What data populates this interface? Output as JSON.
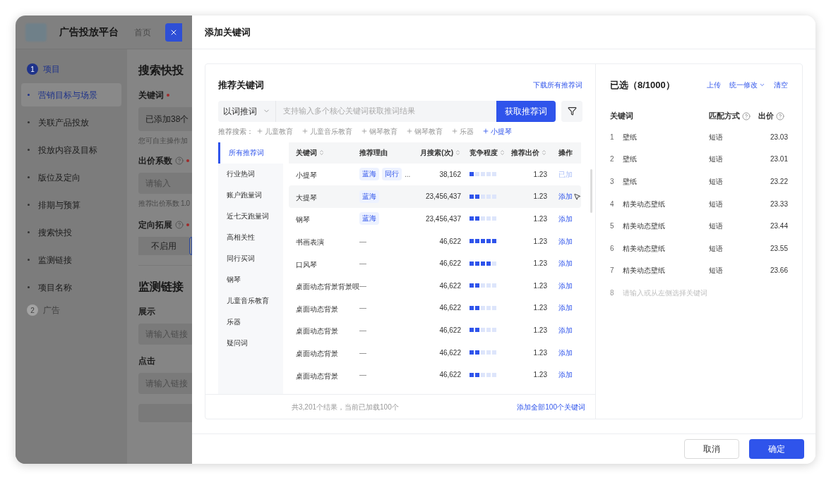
{
  "background_app": {
    "title": "广告投放平台",
    "nav": [
      {
        "label": "首页"
      }
    ],
    "steps": [
      {
        "number": "1",
        "label": "项目",
        "active": true,
        "items": [
          {
            "label": "营销目标与场景",
            "selected": true
          },
          {
            "label": "关联产品投放",
            "selected": false
          },
          {
            "label": "投放内容及目标",
            "selected": false
          },
          {
            "label": "版位及定向",
            "selected": false
          },
          {
            "label": "排期与预算",
            "selected": false
          },
          {
            "label": "搜索快投",
            "selected": false
          },
          {
            "label": "监测链接",
            "selected": false
          },
          {
            "label": "项目名称",
            "selected": false
          }
        ]
      },
      {
        "number": "2",
        "label": "广告",
        "active": false
      }
    ],
    "sections": [
      {
        "title": "搜索快投",
        "fields": [
          {
            "kind": "value",
            "label": "关键词",
            "required": true,
            "help": false,
            "value": "已添加38个",
            "hint": "您可自主操作加"
          },
          {
            "kind": "input",
            "label": "出价系数",
            "required": true,
            "help": true,
            "placeholder": "请输入",
            "hint": "推荐出价系数 1.0"
          },
          {
            "kind": "segmented",
            "label": "定向拓展",
            "required": true,
            "help": true,
            "options": [
              "不启用"
            ]
          }
        ]
      },
      {
        "title": "监测链接",
        "fields": [
          {
            "kind": "input",
            "label": "展示",
            "required": false,
            "help": false,
            "placeholder": "请输入链接"
          },
          {
            "kind": "input",
            "label": "点击",
            "required": false,
            "help": false,
            "placeholder": "请输入链接"
          },
          {
            "kind": "block"
          }
        ]
      }
    ]
  },
  "drawer": {
    "title": "添加关键词",
    "recommend": {
      "title": "推荐关键词",
      "download_link": "下载所有推荐词",
      "mode": "以词推词",
      "search_placeholder": "支持输入多个核心关键词获取推词结果",
      "search_button": "获取推荐词",
      "suggest_label": "推荐搜索：",
      "suggestions": [
        {
          "label": "儿童教育",
          "selected": false
        },
        {
          "label": "儿童音乐教育",
          "selected": false
        },
        {
          "label": "钢琴教育",
          "selected": false
        },
        {
          "label": "钢琴教育",
          "selected": false
        },
        {
          "label": "乐器",
          "selected": false
        },
        {
          "label": "小提琴",
          "selected": true
        }
      ],
      "categories": [
        {
          "label": "所有推荐词",
          "selected": true
        },
        {
          "label": "行业热词",
          "selected": false
        },
        {
          "label": "账户跑量词",
          "selected": false
        },
        {
          "label": "近七天跑量词",
          "selected": false
        },
        {
          "label": "高相关性",
          "selected": false
        },
        {
          "label": "同行买词",
          "selected": false
        },
        {
          "label": "钢琴",
          "selected": false
        },
        {
          "label": "儿童音乐教育",
          "selected": false
        },
        {
          "label": "乐器",
          "selected": false
        },
        {
          "label": "疑问词",
          "selected": false
        }
      ],
      "table": {
        "columns": [
          {
            "label": "关键词",
            "sortable": true
          },
          {
            "label": "推荐理由",
            "sortable": false
          },
          {
            "label": "月搜索(次)",
            "sortable": true
          },
          {
            "label": "竞争程度",
            "sortable": true
          },
          {
            "label": "推荐出价",
            "sortable": true
          },
          {
            "label": "操作",
            "sortable": false
          }
        ],
        "rows": [
          {
            "keyword": "小提琴",
            "tags": [
              "蓝海",
              "同行"
            ],
            "more": "...",
            "searches": "38,162",
            "level": 0.2,
            "bid": "1.23",
            "action": "已加",
            "added": true,
            "highlighted": false
          },
          {
            "keyword": "大提琴",
            "tags": [
              "蓝海"
            ],
            "searches": "23,456,437",
            "level": 0.4,
            "bid": "1.23",
            "action": "添加",
            "added": false,
            "highlighted": true
          },
          {
            "keyword": "钢琴",
            "tags": [
              "蓝海"
            ],
            "searches": "23,456,437",
            "level": 0.4,
            "bid": "1.23",
            "action": "添加",
            "added": false,
            "highlighted": false
          },
          {
            "keyword": "书画表演",
            "reason": "—",
            "searches": "46,622",
            "level": 1,
            "bid": "1.23",
            "action": "添加",
            "added": false,
            "highlighted": false
          },
          {
            "keyword": "口风琴",
            "reason": "—",
            "searches": "46,622",
            "level": 0.8,
            "bid": "1.23",
            "action": "添加",
            "added": false,
            "highlighted": false
          },
          {
            "keyword": "桌面动态背景背景呗",
            "reason": "—",
            "searches": "46,622",
            "level": 0.4,
            "bid": "1.23",
            "action": "添加",
            "added": false,
            "highlighted": false
          },
          {
            "keyword": "桌面动态背景",
            "reason": "—",
            "searches": "46,622",
            "level": 0.4,
            "bid": "1.23",
            "action": "添加",
            "added": false,
            "highlighted": false
          },
          {
            "keyword": "桌面动态背景",
            "reason": "—",
            "searches": "46,622",
            "level": 0.4,
            "bid": "1.23",
            "action": "添加",
            "added": false,
            "highlighted": false
          },
          {
            "keyword": "桌面动态背景",
            "reason": "—",
            "searches": "46,622",
            "level": 0.4,
            "bid": "1.23",
            "action": "添加",
            "added": false,
            "highlighted": false
          },
          {
            "keyword": "桌面动态背景",
            "reason": "—",
            "searches": "46,622",
            "level": 0.4,
            "bid": "1.23",
            "action": "添加",
            "added": false,
            "highlighted": false
          }
        ]
      },
      "summary": "共3,201个结果，当前已加载100个",
      "add_all": "添加全部100个关键词"
    },
    "selected": {
      "title": "已选（8/1000）",
      "actions": [
        {
          "label": "上传",
          "dropdown": false
        },
        {
          "label": "统一修改",
          "dropdown": true
        },
        {
          "label": "清空",
          "dropdown": false
        }
      ],
      "columns": [
        {
          "label": "关键词",
          "help": false
        },
        {
          "label": "匹配方式",
          "help": true
        },
        {
          "label": "出价",
          "help": true
        }
      ],
      "rows": [
        {
          "index": "1",
          "keyword": "壁纸",
          "match": "短语",
          "bid": "23.03"
        },
        {
          "index": "2",
          "keyword": "壁纸",
          "match": "短语",
          "bid": "23.01"
        },
        {
          "index": "3",
          "keyword": "壁纸",
          "match": "短语",
          "bid": "23.22"
        },
        {
          "index": "4",
          "keyword": "精美动态壁纸",
          "match": "短语",
          "bid": "23.33"
        },
        {
          "index": "5",
          "keyword": "精美动态壁纸",
          "match": "短语",
          "bid": "23.44"
        },
        {
          "index": "6",
          "keyword": "精美动态壁纸",
          "match": "短语",
          "bid": "23.55"
        },
        {
          "index": "7",
          "keyword": "精美动态壁纸",
          "match": "短语",
          "bid": "23.66"
        }
      ],
      "new_row": {
        "index": "8",
        "placeholder": "请输入或从左侧选择关键词"
      }
    },
    "buttons": [
      {
        "label": "取消",
        "kind": "secondary"
      },
      {
        "label": "确定",
        "kind": "primary"
      }
    ]
  }
}
